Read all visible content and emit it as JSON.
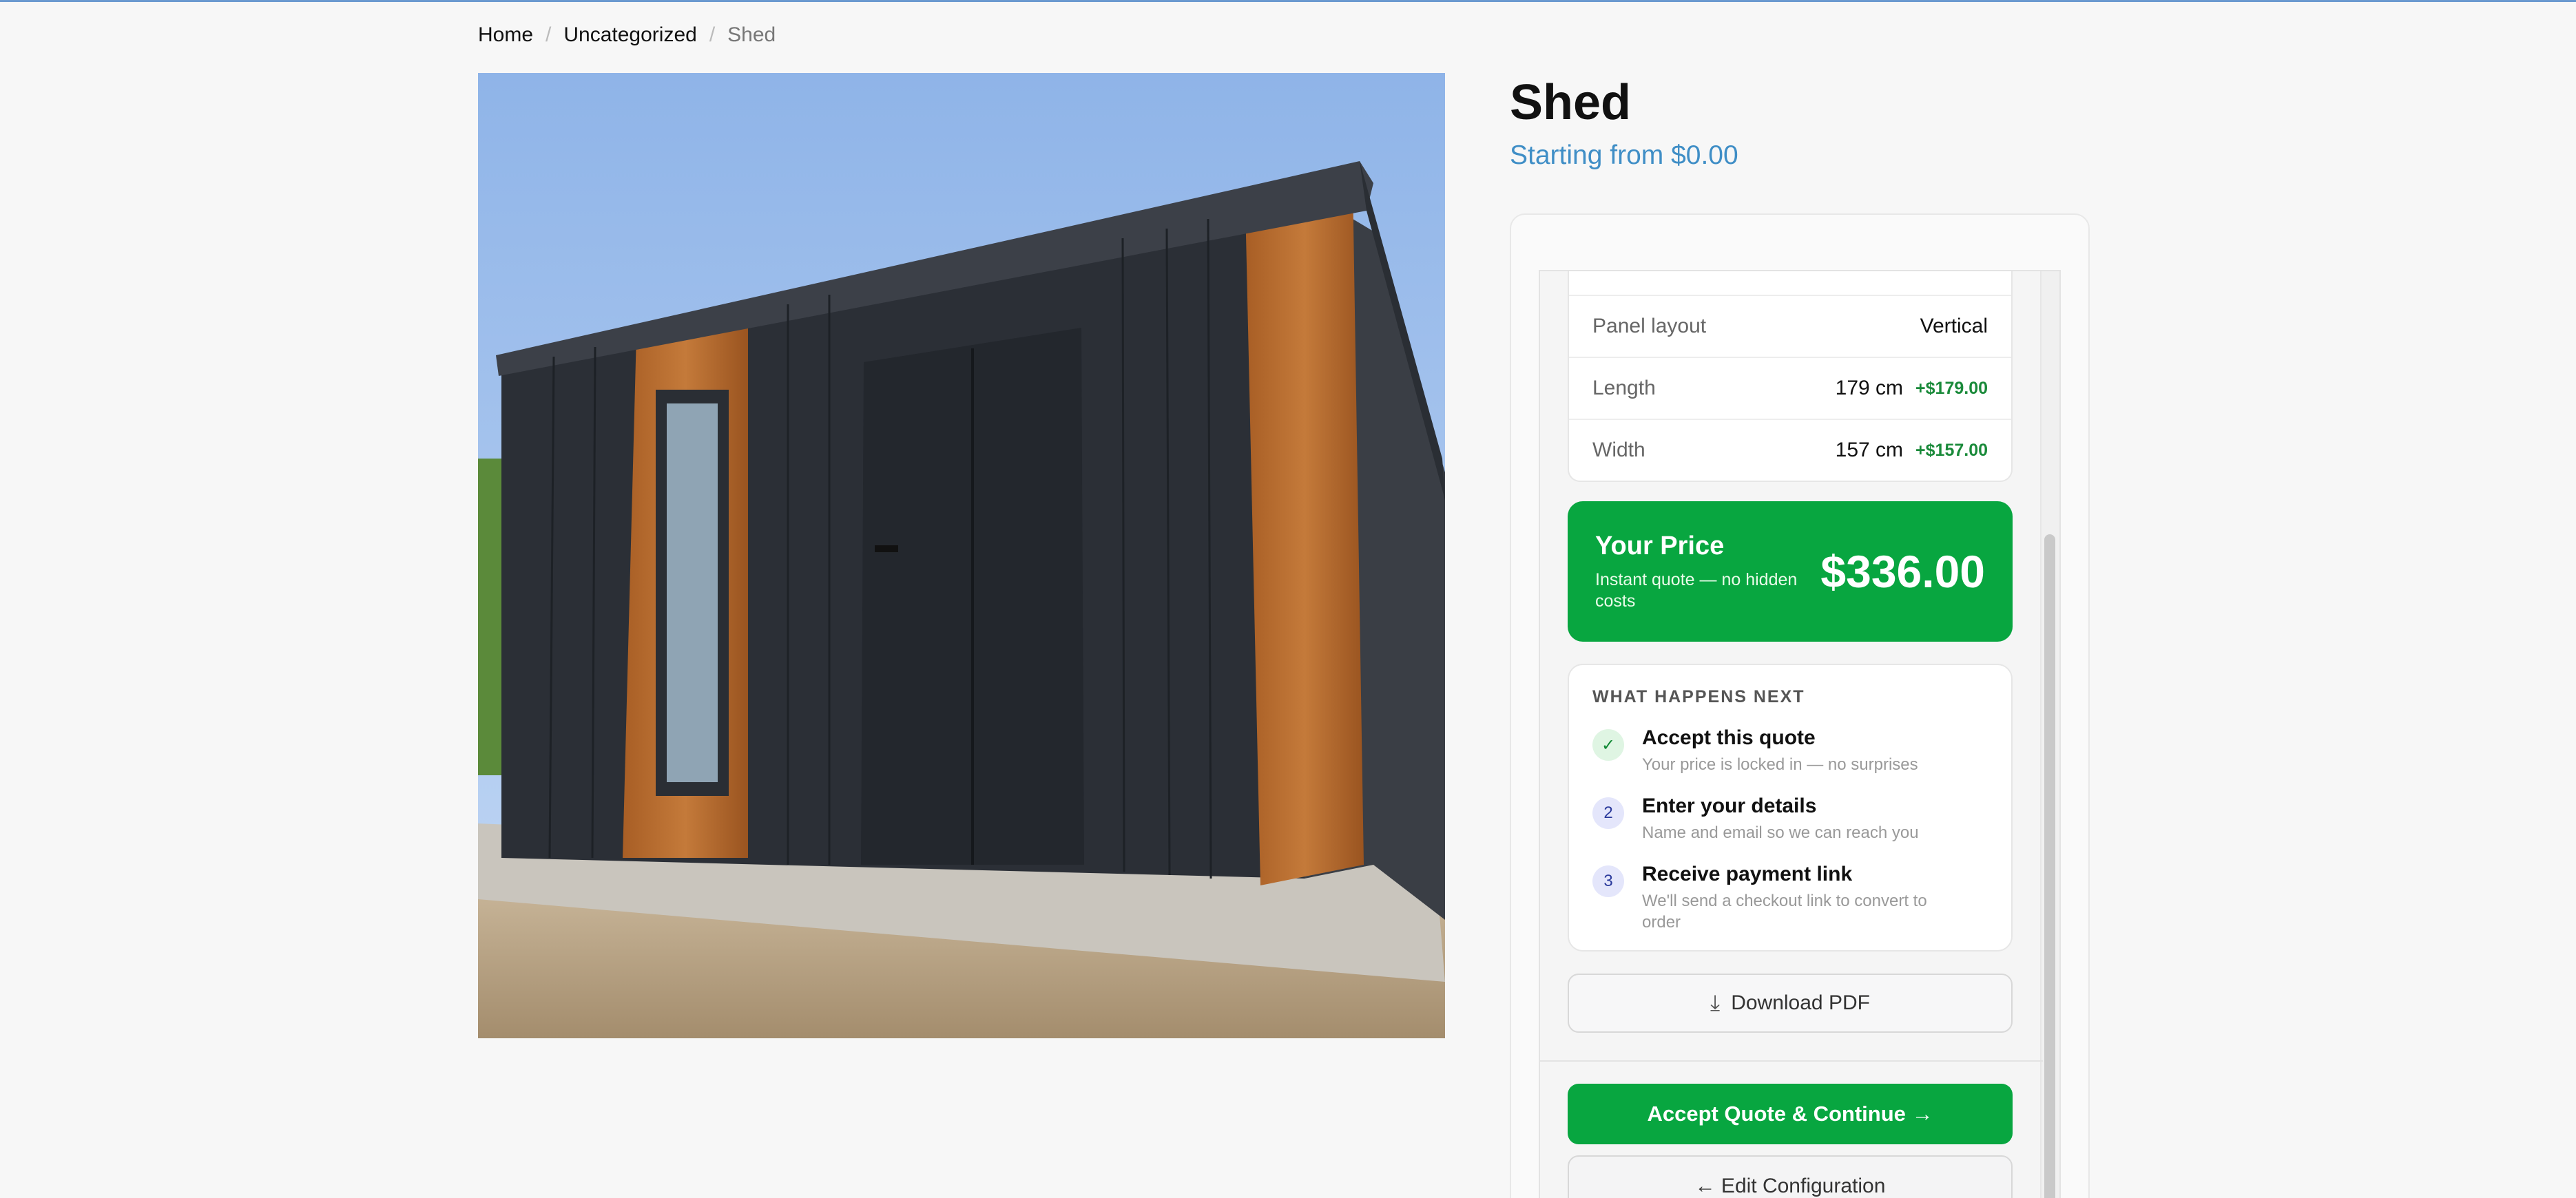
{
  "breadcrumb": {
    "items": [
      "Home",
      "Uncategorized",
      "Shed"
    ]
  },
  "product": {
    "title": "Shed",
    "starting_price": "Starting from $0.00",
    "image_alt": "shed-photo"
  },
  "specs": [
    {
      "label": "Panel layout",
      "value": "Vertical",
      "delta": ""
    },
    {
      "label": "Length",
      "value": "179 cm",
      "delta": "+$179.00"
    },
    {
      "label": "Width",
      "value": "157 cm",
      "delta": "+$157.00"
    }
  ],
  "price_card": {
    "heading": "Your Price",
    "note": "Instant quote — no hidden costs",
    "amount": "$336.00"
  },
  "next_steps": {
    "heading": "WHAT HAPPENS NEXT",
    "steps": [
      {
        "badge": "✓",
        "title": "Accept this quote",
        "desc": "Your price is locked in — no surprises"
      },
      {
        "badge": "2",
        "title": "Enter your details",
        "desc": "Name and email so we can reach you"
      },
      {
        "badge": "3",
        "title": "Receive payment link",
        "desc": "We'll send a checkout link to convert to order"
      }
    ]
  },
  "actions": {
    "download_pdf": "Download PDF",
    "accept": "Accept Quote & Continue →",
    "edit": "← Edit Configuration"
  },
  "colors": {
    "accent_green": "#08a640",
    "link_blue": "#3f8ec6"
  }
}
